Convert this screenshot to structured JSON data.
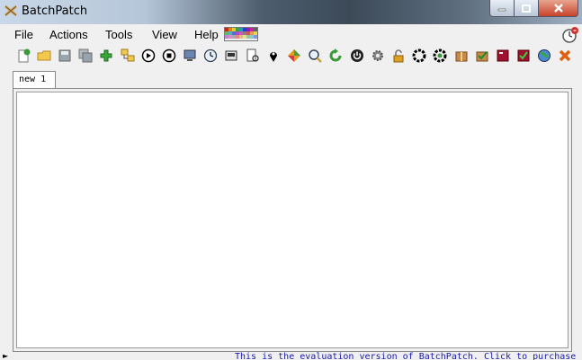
{
  "window": {
    "title": "BatchPatch",
    "buttons": {
      "minimize": "minimize",
      "maximize": "maximize",
      "close": "close"
    }
  },
  "menu": {
    "items": [
      {
        "label": "File"
      },
      {
        "label": "Actions"
      },
      {
        "label": "Tools"
      },
      {
        "label": "View"
      },
      {
        "label": "Help"
      }
    ]
  },
  "toolbar": {
    "icons": [
      "new-host-icon",
      "open-folder-icon",
      "save-icon",
      "save-all-icon",
      "add-icon",
      "group-icon",
      "play-icon",
      "stop-icon",
      "remote-desktop-icon",
      "schedule-icon",
      "deploy-icon",
      "document-search-icon",
      "location-pin-icon",
      "diamond-icon",
      "magnifier-icon",
      "refresh-icon",
      "power-icon",
      "settings-gear-icon",
      "unlock-icon",
      "black-ring-icon",
      "spinner-icon",
      "package-icon",
      "check-package-icon",
      "red-box-icon",
      "red-check-icon",
      "globe-icon",
      "remove-icon"
    ]
  },
  "tabs": [
    {
      "label": "new 1",
      "active": true
    }
  ],
  "status": {
    "text": "This is the evaluation version of BatchPatch.  Click to purchase"
  },
  "colors": {
    "accent": "#1a1aa6",
    "editor_bg": "#ffffff",
    "chrome_bg": "#f0f0f0"
  }
}
